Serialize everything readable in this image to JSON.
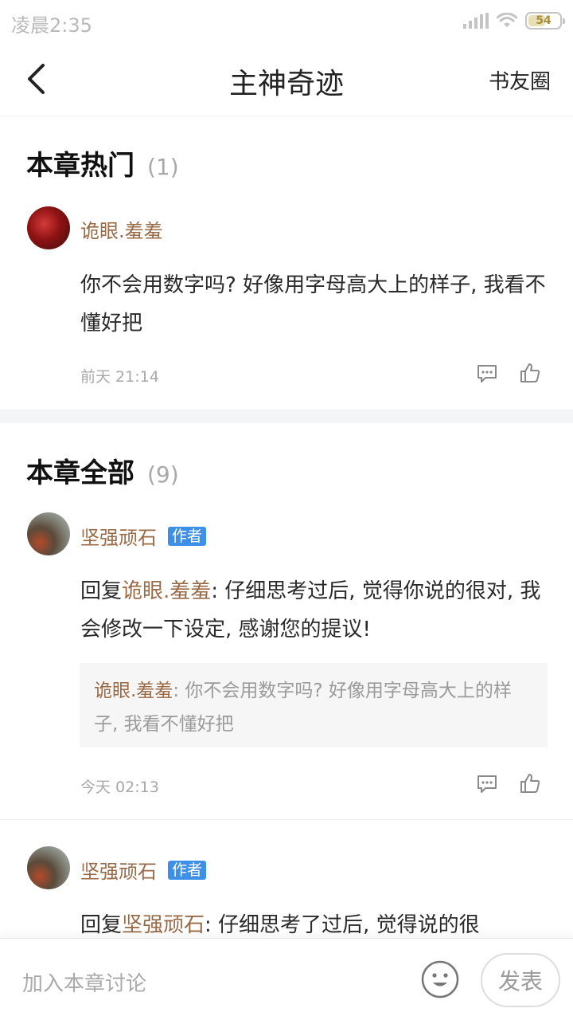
{
  "status_bar": {
    "time": "凌晨2:35",
    "battery": "54",
    "battery_level": 0.54
  },
  "nav": {
    "title": "主神奇迹",
    "right_label": "书友圈"
  },
  "hot": {
    "title": "本章热门",
    "count": "(1)",
    "comment": {
      "user": "诡眼.羞羞",
      "text": "你不会用数字吗? 好像用字母高大上的样子, 我看不懂好把",
      "time": "前天 21:14"
    }
  },
  "all": {
    "title": "本章全部",
    "count": "(9)",
    "comments": [
      {
        "user": "坚强顽石",
        "badge": "作者",
        "reply_prefix": "回复",
        "reply_to": "诡眼.羞羞",
        "text": ": 仔细思考过后, 觉得你说的很对, 我会修改一下设定, 感谢您的提议!",
        "quote_user": "诡眼.羞羞",
        "quote_text": ": 你不会用数字吗? 好像用字母高大上的样子, 我看不懂好把",
        "time": "今天 02:13"
      },
      {
        "user": "坚强顽石",
        "badge": "作者",
        "reply_prefix": "回复",
        "reply_to": "坚强顽石",
        "text": ": 仔细思考了过后, 觉得说的很"
      }
    ]
  },
  "bottom": {
    "placeholder": "加入本章讨论",
    "post_label": "发表"
  },
  "icons": {
    "back": "back-arrow-icon",
    "emoji": "smiley-icon",
    "comment": "comment-icon",
    "like": "thumbs-up-icon"
  },
  "colors": {
    "username": "#9a6a46",
    "badge": "#3d8fe8",
    "muted": "#a8a8a8"
  }
}
